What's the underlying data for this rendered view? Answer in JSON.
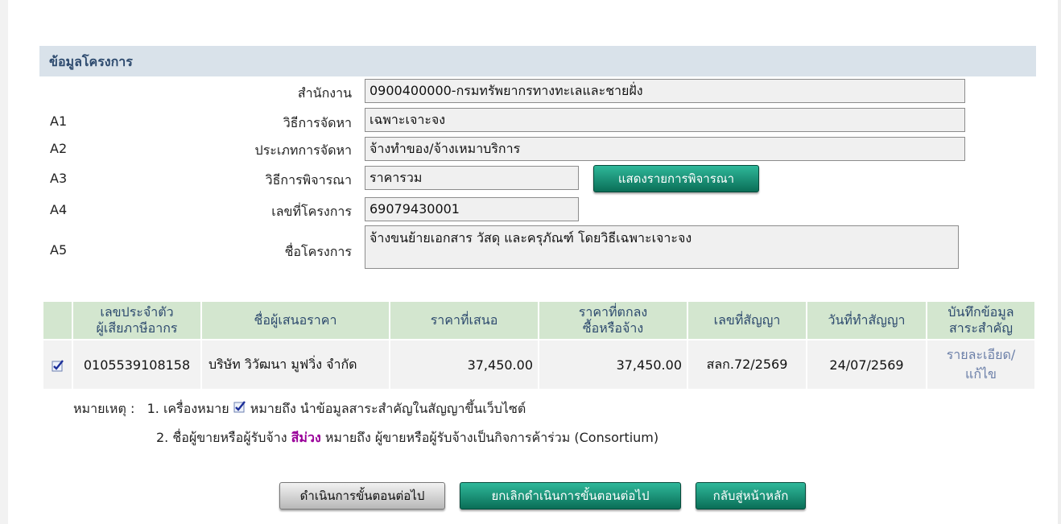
{
  "section": {
    "title": "ข้อมูลโครงการ"
  },
  "fields": {
    "agency": {
      "label": "สำนักงาน",
      "value": "0900400000-กรมทรัพยากรทางทะเลและชายฝั่ง"
    },
    "a1": {
      "code": "A1",
      "label": "วิธีการจัดหา",
      "value": "เฉพาะเจาะจง"
    },
    "a2": {
      "code": "A2",
      "label": "ประเภทการจัดหา",
      "value": "จ้างทำของ/จ้างเหมาบริการ"
    },
    "a3": {
      "code": "A3",
      "label": "วิธีการพิจารณา",
      "value": "ราคารวม",
      "button": "แสดงรายการพิจารณา"
    },
    "a4": {
      "code": "A4",
      "label": "เลขที่โครงการ",
      "value": "69079430001"
    },
    "a5": {
      "code": "A5",
      "label": "ชื่อโครงการ",
      "value": "จ้างขนย้ายเอกสาร วัสดุ และครุภัณฑ์ โดยวิธีเฉพาะเจาะจง"
    }
  },
  "table": {
    "headers": {
      "tax_id_1": "เลขประจำตัว",
      "tax_id_2": "ผู้เสียภาษีอากร",
      "bidder": "ชื่อผู้เสนอราคา",
      "offer_price": "ราคาที่เสนอ",
      "agreed_1": "ราคาที่ตกลง",
      "agreed_2": "ซื้อหรือจ้าง",
      "contract_no": "เลขที่สัญญา",
      "contract_date": "วันที่ทำสัญญา",
      "record_1": "บันทึกข้อมูล",
      "record_2": "สาระสำคัญ"
    },
    "rows": [
      {
        "tax_id": "0105539108158",
        "bidder": "บริษัท วิวัฒนา มูฟวิ่ง จำกัด",
        "offer_price": "37,450.00",
        "agreed_price": "37,450.00",
        "contract_no": "สลก.72/2569",
        "contract_date": "24/07/2569",
        "link_1": "รายละเอียด/",
        "link_2": "แก้ไข"
      }
    ]
  },
  "notes": {
    "prefix": "หมายเหตุ :",
    "n1_a": "1. เครื่องหมาย",
    "n1_b": "หมายถึง นำข้อมูลสาระสำคัญในสัญญาขึ้นเว็บไซต์",
    "n2_a": "2. ชื่อผู้ขายหรือผู้รับจ้าง",
    "n2_purple": "สีม่วง",
    "n2_b": "หมายถึง ผู้ขายหรือผู้รับจ้างเป็นกิจการค้าร่วม (Consortium)"
  },
  "buttons": {
    "next": "ดำเนินการขั้นตอนต่อไป",
    "cancel_next": "ยกเลิกดำเนินการขั้นตอนต่อไป",
    "home": "กลับสู่หน้าหลัก"
  },
  "colors": {
    "header_bg": "#d9e2ea",
    "table_header_bg": "#d3e6cf",
    "button_green": "#0a6e57",
    "consortium_purple": "#990099"
  }
}
